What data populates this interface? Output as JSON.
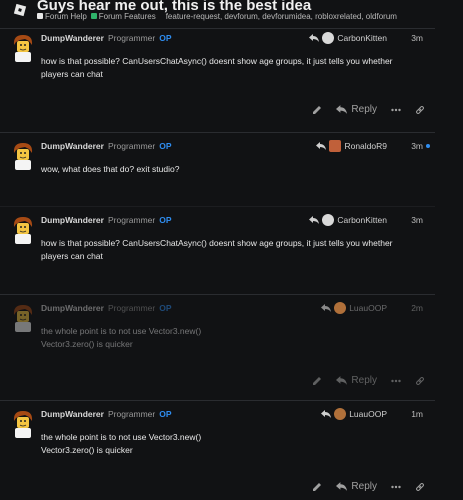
{
  "topic": {
    "title": "Guys hear me out, this is the best idea",
    "category_parent": "Forum Help",
    "category_parent_color": "#e8e8e8",
    "category": "Forum Features",
    "category_color": "#2fb36a",
    "tags": "feature-request, devforum, devforumidea, robloxrelated, oldforum"
  },
  "posts": [
    {
      "username": "DumpWanderer",
      "title": "Programmer",
      "badge": "OP",
      "reply_to": "CarbonKitten",
      "time": "3m",
      "lines": [
        "how is that possible? CanUsersChatAsync() doesnt show age groups, it just tells you whether",
        "players can chat"
      ],
      "reply_label": "Reply"
    },
    {
      "username": "DumpWanderer",
      "title": "Programmer",
      "badge": "OP",
      "reply_to": "RonaldoR9",
      "time": "3m",
      "lines": [
        "wow, what does that do? exit studio?"
      ],
      "reply_label": ""
    },
    {
      "username": "DumpWanderer",
      "title": "Programmer",
      "badge": "OP",
      "reply_to": "CarbonKitten",
      "time": "3m",
      "lines": [
        "how is that possible? CanUsersChatAsync() doesnt show age groups, it just tells you whether",
        "players can chat"
      ],
      "reply_label": ""
    },
    {
      "username": "DumpWanderer",
      "title": "Programmer",
      "badge": "OP",
      "reply_to": "LuauOOP",
      "time": "2m",
      "lines": [
        "the whole point is to not use Vector3.new()",
        "Vector3.zero() is quicker"
      ],
      "reply_label": "Reply"
    },
    {
      "username": "DumpWanderer",
      "title": "Programmer",
      "badge": "OP",
      "reply_to": "LuauOOP",
      "time": "1m",
      "lines": [
        "the whole point is to not use Vector3.new()",
        "Vector3.zero() is quicker"
      ],
      "reply_label": "Reply"
    }
  ],
  "icons": {
    "logo": "roblox-logo-icon",
    "edit": "pencil-icon",
    "reply": "reply-arrow-icon",
    "more": "ellipsis-icon",
    "link": "link-icon"
  },
  "colors": {
    "op_badge": "#2f8df0",
    "unread_dot": "#2f8df0"
  }
}
